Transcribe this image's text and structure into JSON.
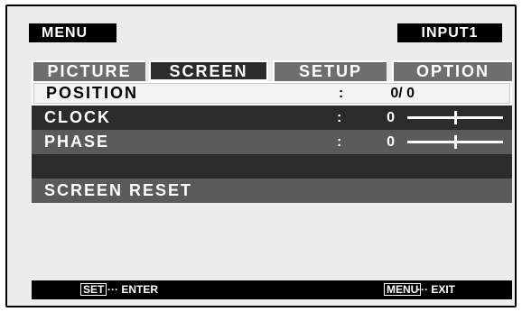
{
  "header": {
    "menu_label": "MENU",
    "input_label": "INPUT1"
  },
  "tabs": [
    {
      "label": "PICTURE",
      "active": false
    },
    {
      "label": "SCREEN",
      "active": true
    },
    {
      "label": "SETUP",
      "active": false
    },
    {
      "label": "OPTION",
      "active": false
    }
  ],
  "rows": {
    "position": {
      "label": "POSITION",
      "colon": ":",
      "value": "0/ 0"
    },
    "clock": {
      "label": "CLOCK",
      "colon": ":",
      "value": "0",
      "slider_fraction": 0.5
    },
    "phase": {
      "label": "PHASE",
      "colon": ":",
      "value": "0",
      "slider_fraction": 0.5
    },
    "reset": {
      "label": "SCREEN RESET"
    }
  },
  "footer": {
    "left_key": "SET",
    "left_hint": "··· ENTER",
    "right_key": "MENU",
    "right_hint": "··· EXIT"
  },
  "colors": {
    "selected_row": "#f3f3f3",
    "dark_row": "#2b2b2b",
    "mid_row": "#5a5a5a",
    "panel": "#ececec"
  }
}
